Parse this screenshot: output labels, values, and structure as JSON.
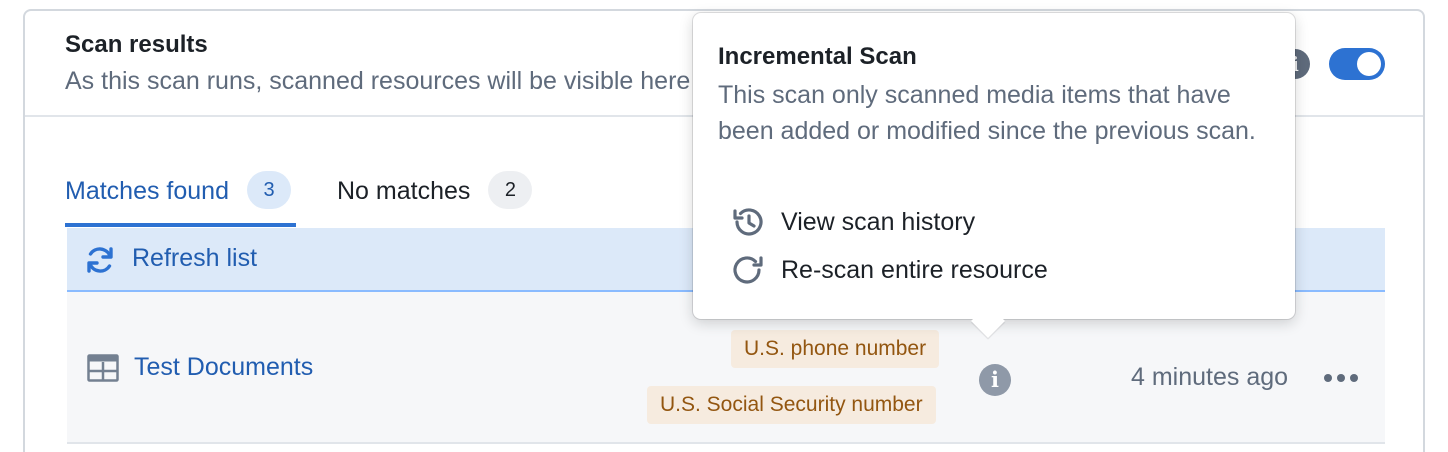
{
  "header": {
    "title": "Scan results",
    "subtitle": "As this scan runs, scanned resources will be visible here"
  },
  "tabs": [
    {
      "label": "Matches found",
      "count": "3",
      "active": true
    },
    {
      "label": "No matches",
      "count": "2",
      "active": false
    }
  ],
  "toolbar": {
    "refresh_label": "Refresh list"
  },
  "results": [
    {
      "name": "Test Documents",
      "tags": [
        "U.S. phone number",
        "U.S. Social Security number"
      ],
      "time": "4 minutes ago"
    }
  ],
  "popover": {
    "title": "Incremental Scan",
    "description": "This scan only scanned media items that have been added or modified since the previous scan.",
    "items": [
      {
        "label": "View scan history",
        "icon": "history-icon"
      },
      {
        "label": "Re-scan entire resource",
        "icon": "rescan-icon"
      }
    ]
  },
  "colors": {
    "accent": "#2d72d2",
    "link": "#215db0",
    "tag_bg": "#f6ebdf",
    "tag_text": "#935610",
    "refresh_bg": "#dce9f9"
  }
}
